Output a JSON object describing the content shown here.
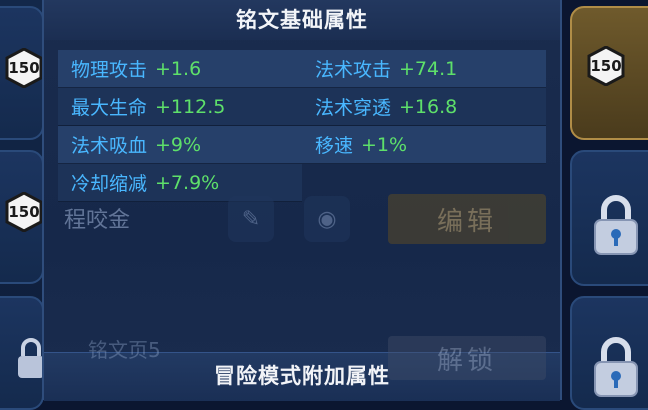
{
  "dialog": {
    "title": "铭文基础属性",
    "section_footer": "冒险模式附加属性",
    "attributes": [
      {
        "name": "物理攻击",
        "value": "+1.6"
      },
      {
        "name": "法术攻击",
        "value": "+74.1"
      },
      {
        "name": "最大生命",
        "value": "+112.5"
      },
      {
        "name": "法术穿透",
        "value": "+16.8"
      },
      {
        "name": "法术吸血",
        "value": "+9%"
      },
      {
        "name": "移速",
        "value": "+1%"
      },
      {
        "name": "冷却缩减",
        "value": "+7.9%"
      }
    ]
  },
  "background": {
    "badge_level": "150",
    "hero_name": "程咬金",
    "edit_button": "编辑",
    "page_name": "铭文页5",
    "unlock_button": "解锁"
  },
  "colors": {
    "attr_name": "#49b7ff",
    "attr_value": "#5ee06a",
    "title_text": "#f2f4f8",
    "gold_card": "#b08d47"
  },
  "icons": [
    "level-badge-icon",
    "lock-icon",
    "pencil-icon",
    "eye-icon"
  ]
}
